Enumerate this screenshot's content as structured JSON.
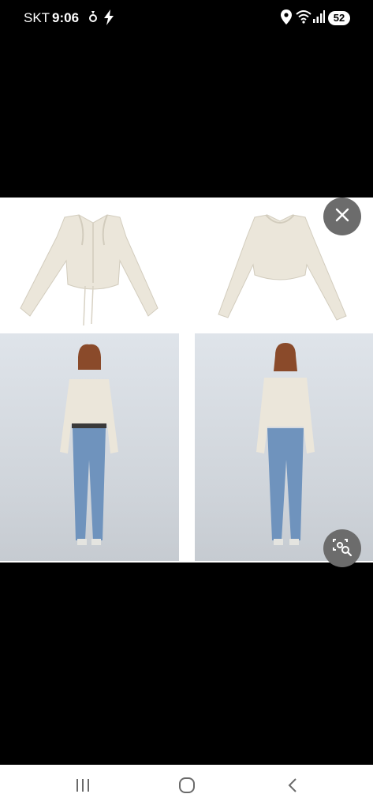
{
  "status_bar": {
    "carrier": "SKT",
    "time": "9:06",
    "battery": "52"
  },
  "photo": {
    "background_color": "#ffffff",
    "garment_color": "#ebe6da",
    "denim_color": "#6f93bd"
  },
  "controls": {
    "close_icon": "close-icon",
    "lens_icon": "image-search-icon",
    "button_color": "#6c6c6c"
  },
  "nav_bar": {
    "recents_icon": "recents-icon",
    "home_icon": "home-icon",
    "back_icon": "back-icon"
  }
}
